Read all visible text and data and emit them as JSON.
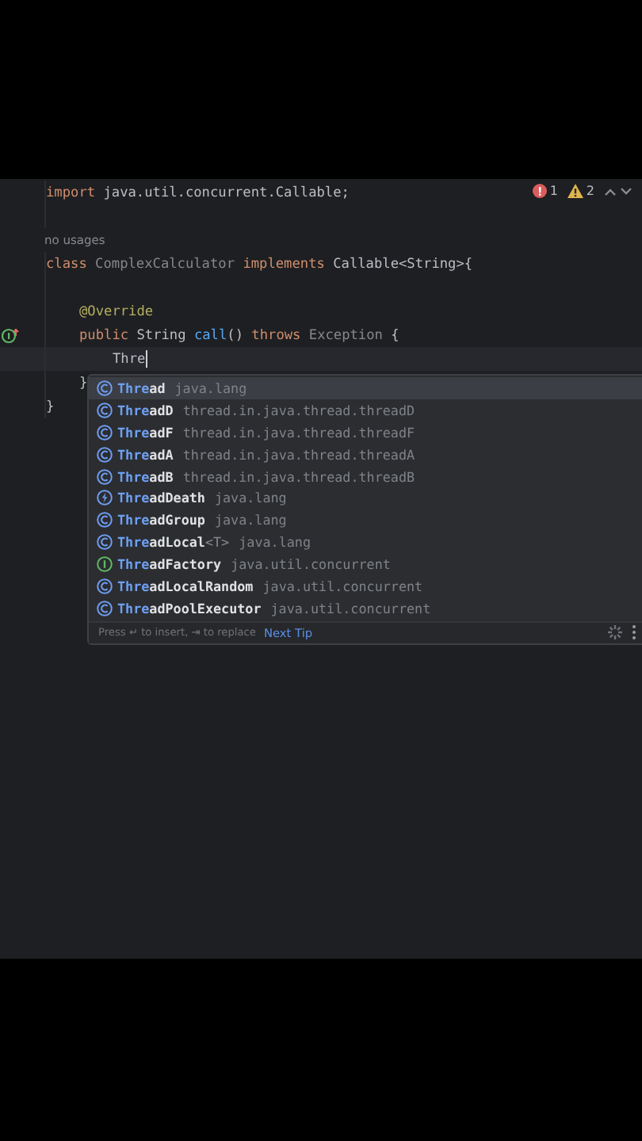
{
  "inspections": {
    "errors": "1",
    "warnings": "2"
  },
  "code_lines": [
    {
      "kind": "code",
      "tokens": [
        {
          "text": "import",
          "kind": "keyword"
        },
        {
          "text": " java.util.concurrent.Callable;",
          "kind": "plain"
        }
      ]
    },
    {
      "kind": "blank"
    },
    {
      "kind": "code",
      "hint": "no usages",
      "tokens": [
        {
          "text": "class",
          "kind": "keyword"
        },
        {
          "text": " ComplexCalculator",
          "kind": "unused"
        },
        {
          "text": " implements",
          "kind": "keyword"
        },
        {
          "text": " Callable<String>{",
          "kind": "plain"
        }
      ],
      "children": [
        {
          "kind": "blank"
        },
        {
          "kind": "code",
          "tokens": [
            {
              "text": "@Override",
              "kind": "annotation"
            }
          ]
        },
        {
          "kind": "code",
          "overrides": true,
          "tokens": [
            {
              "text": "public",
              "kind": "keyword"
            },
            {
              "text": " String",
              "kind": "plain"
            },
            {
              "text": " call",
              "kind": "method"
            },
            {
              "text": "()",
              "kind": "plain"
            },
            {
              "text": " throws",
              "kind": "keyword"
            },
            {
              "text": " Exception",
              "kind": "unused"
            },
            {
              "text": " {",
              "kind": "plain"
            }
          ],
          "children": [
            {
              "kind": "code",
              "current": true,
              "caret": true,
              "tokens": [
                {
                  "text": "Thre",
                  "kind": "plain"
                }
              ]
            }
          ]
        },
        {
          "kind": "code",
          "tokens": [
            {
              "text": "}",
              "kind": "plain"
            }
          ]
        }
      ]
    },
    {
      "kind": "code",
      "tokens": [
        {
          "text": "}",
          "kind": "plain"
        }
      ]
    }
  ],
  "completion": {
    "items": [
      {
        "kind": "class",
        "match": "Thre",
        "rest": "ad",
        "package": "java.lang",
        "selected": true
      },
      {
        "kind": "class",
        "match": "Thre",
        "rest": "adD",
        "package": "thread.in.java.thread.threadD",
        "selected": false
      },
      {
        "kind": "class",
        "match": "Thre",
        "rest": "adF",
        "package": "thread.in.java.thread.threadF",
        "selected": false
      },
      {
        "kind": "class",
        "match": "Thre",
        "rest": "adA",
        "package": "thread.in.java.thread.threadA",
        "selected": false
      },
      {
        "kind": "class",
        "match": "Thre",
        "rest": "adB",
        "package": "thread.in.java.thread.threadB",
        "selected": false
      },
      {
        "kind": "exception",
        "match": "Thre",
        "rest": "adDeath",
        "package": "java.lang",
        "selected": false
      },
      {
        "kind": "class",
        "match": "Thre",
        "rest": "adGroup",
        "package": "java.lang",
        "selected": false
      },
      {
        "kind": "class",
        "match": "Thre",
        "rest": "adLocal",
        "generic": "<T>",
        "package": "java.lang",
        "selected": false
      },
      {
        "kind": "interface",
        "match": "Thre",
        "rest": "adFactory",
        "package": "java.util.concurrent",
        "selected": false
      },
      {
        "kind": "class",
        "match": "Thre",
        "rest": "adLocalRandom",
        "package": "java.util.concurrent",
        "selected": false
      },
      {
        "kind": "class",
        "match": "Thre",
        "rest": "adPoolExecutor",
        "package": "java.util.concurrent",
        "selected": false
      }
    ],
    "footer_hint": "Press ↵ to insert, ⇥ to replace",
    "footer_link": "Next Tip"
  }
}
